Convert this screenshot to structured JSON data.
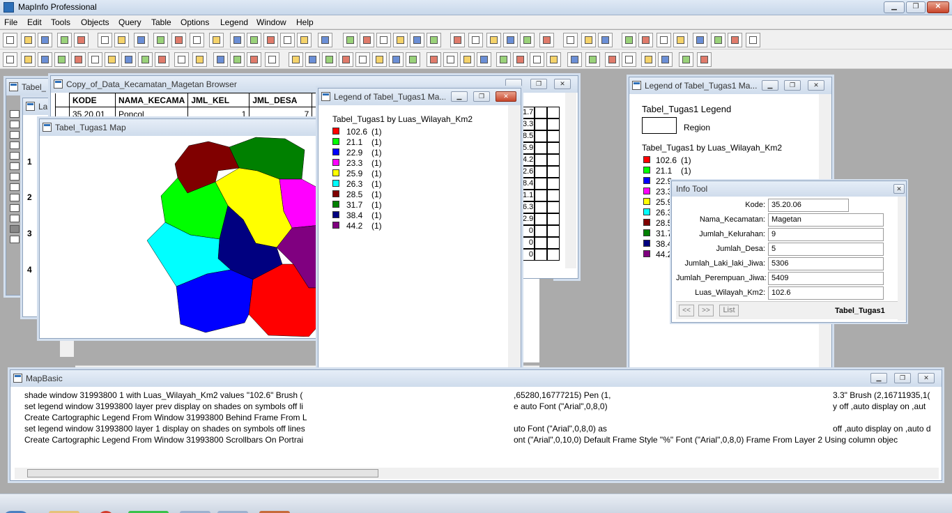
{
  "app": {
    "title": "MapInfo Professional"
  },
  "menu": [
    "File",
    "Edit",
    "Tools",
    "Objects",
    "Query",
    "Table",
    "Options",
    "Legend",
    "Window",
    "Help"
  ],
  "colors": {
    "red": "#ff0000",
    "green": "#00ff00",
    "blue": "#0000ff",
    "magenta": "#ff00ff",
    "yellow": "#ffff00",
    "cyan": "#00ffff",
    "maroon": "#800000",
    "dgreen": "#008000",
    "navy": "#000080",
    "purple": "#800080"
  },
  "windows": {
    "table_back": {
      "title": "Tabel_"
    },
    "la_back": {
      "title": "La"
    },
    "browser": {
      "title": "Copy_of_Data_Kecamatan_Magetan Browser",
      "columns": [
        "KODE",
        "NAMA_KECAMA",
        "JML_KEL",
        "JML_DESA"
      ],
      "row1": {
        "kode": "35.20.01",
        "nama": "Poncol",
        "kel": "1",
        "desa": "7"
      },
      "right_values": [
        "1.7",
        "3.3",
        "8.5",
        "5.9",
        "4.2",
        "2.6",
        "8.4",
        "1.1",
        "6.3",
        "2.9",
        "0",
        "0",
        "0"
      ]
    },
    "map": {
      "title": "Tabel_Tugas1 Map"
    },
    "legend_main": {
      "title": "Legend of Tabel_Tugas1 Ma...",
      "heading": "Tabel_Tugas1 by Luas_Wilayah_Km2",
      "items": [
        {
          "value": "102.6",
          "count": "(1)",
          "color": "#ff0000"
        },
        {
          "value": "21.1",
          "count": "(1)",
          "color": "#00ff00"
        },
        {
          "value": "22.9",
          "count": "(1)",
          "color": "#0000ff"
        },
        {
          "value": "23.3",
          "count": "(1)",
          "color": "#ff00ff"
        },
        {
          "value": "25.9",
          "count": "(1)",
          "color": "#ffff00"
        },
        {
          "value": "26.3",
          "count": "(1)",
          "color": "#00ffff"
        },
        {
          "value": "28.5",
          "count": "(1)",
          "color": "#800000"
        },
        {
          "value": "31.7",
          "count": "(1)",
          "color": "#008000"
        },
        {
          "value": "38.4",
          "count": "(1)",
          "color": "#000080"
        },
        {
          "value": "44.2",
          "count": "(1)",
          "color": "#800080"
        }
      ]
    },
    "legend_right": {
      "title": "Legend of Tabel_Tugas1 Ma...",
      "heading1": "Tabel_Tugas1 Legend",
      "region": "Region",
      "heading2": "Tabel_Tugas1 by Luas_Wilayah_Km2",
      "item1_value": "102.6",
      "item1_count": "(1)",
      "item2_value": "21.1",
      "item2_count": "(1)",
      "partial": [
        "22.9",
        "23.3",
        "25.9",
        "26.3",
        "28.5",
        "31.7",
        "38.4",
        "44.2"
      ]
    },
    "info": {
      "title": "Info Tool",
      "fields": [
        {
          "label": "Kode:",
          "value": "35.20.06"
        },
        {
          "label": "Nama_Kecamatan:",
          "value": "Magetan"
        },
        {
          "label": "Jumlah_Kelurahan:",
          "value": "9"
        },
        {
          "label": "Jumlah_Desa:",
          "value": "5"
        },
        {
          "label": "Jumlah_Laki_laki_Jiwa:",
          "value": "5306"
        },
        {
          "label": "Jumlah_Perempuan_Jiwa:",
          "value": "5409"
        },
        {
          "label": "Luas_Wilayah_Km2:",
          "value": "102.6"
        }
      ],
      "prev": "<<",
      "next": ">>",
      "list": "List",
      "table": "Tabel_Tugas1"
    },
    "mapbasic": {
      "title": "MapBasic",
      "lines": [
        {
          "left": "shade window 31993800 1 with Luas_Wilayah_Km2 values  \"102.6\" Brush (",
          "mid": ",65280,16777215) Pen (1,",
          "right": "3.3\" Brush (2,16711935,1("
        },
        {
          "left": "set legend window 31993800 layer prev display on shades on symbols off li",
          "mid": "e auto Font (\"Arial\",0,8,0)",
          "right": "y off ,auto display on ,aut"
        },
        {
          "left": "Create Cartographic Legend From Window 31993800 Behind Frame From L",
          "mid": "",
          "right": ""
        },
        {
          "left": "set legend window 31993800 layer 1 display on shades on symbols off lines",
          "mid": "uto Font (\"Arial\",0,8,0) as",
          "right": "off ,auto display on ,auto d"
        },
        {
          "left": "Create Cartographic Legend From Window 31993800 Scrollbars On Portrai",
          "mid": "ont (\"Arial\",0,10,0) Default Frame Style  \"%\"  Font (\"Arial\",0,8,0) Frame From Layer 2 Using column objec",
          "right": ""
        }
      ]
    }
  },
  "row_numbers": [
    "1",
    "2",
    "3",
    "4"
  ]
}
